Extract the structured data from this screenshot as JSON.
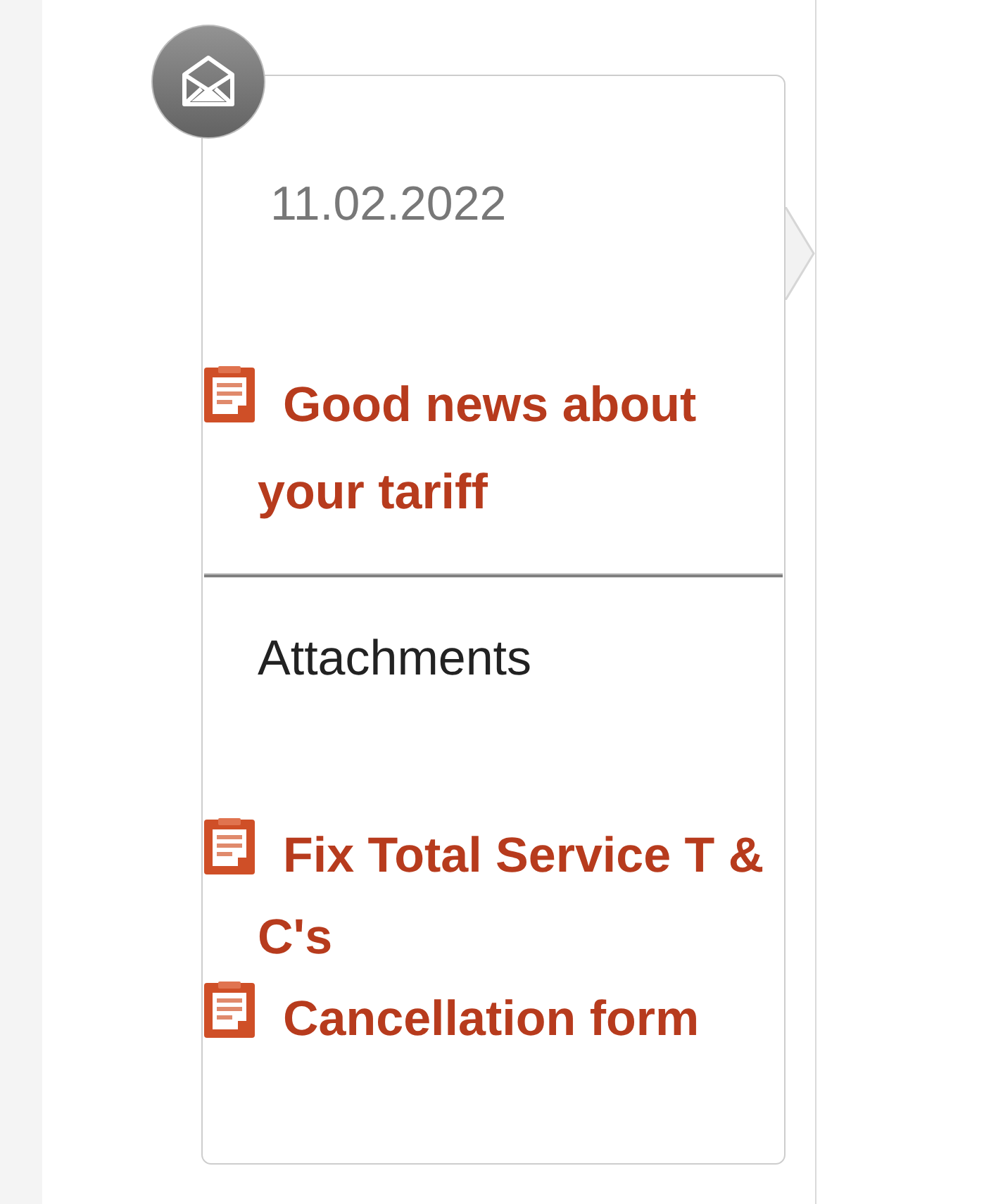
{
  "message": {
    "date": "11.02.2022",
    "document": {
      "title": "Good news about your tariff"
    }
  },
  "attachments": {
    "heading": "Attachments",
    "items": [
      {
        "title": "Fix Total Service T & C's"
      },
      {
        "title": "Cancellation form"
      }
    ]
  }
}
